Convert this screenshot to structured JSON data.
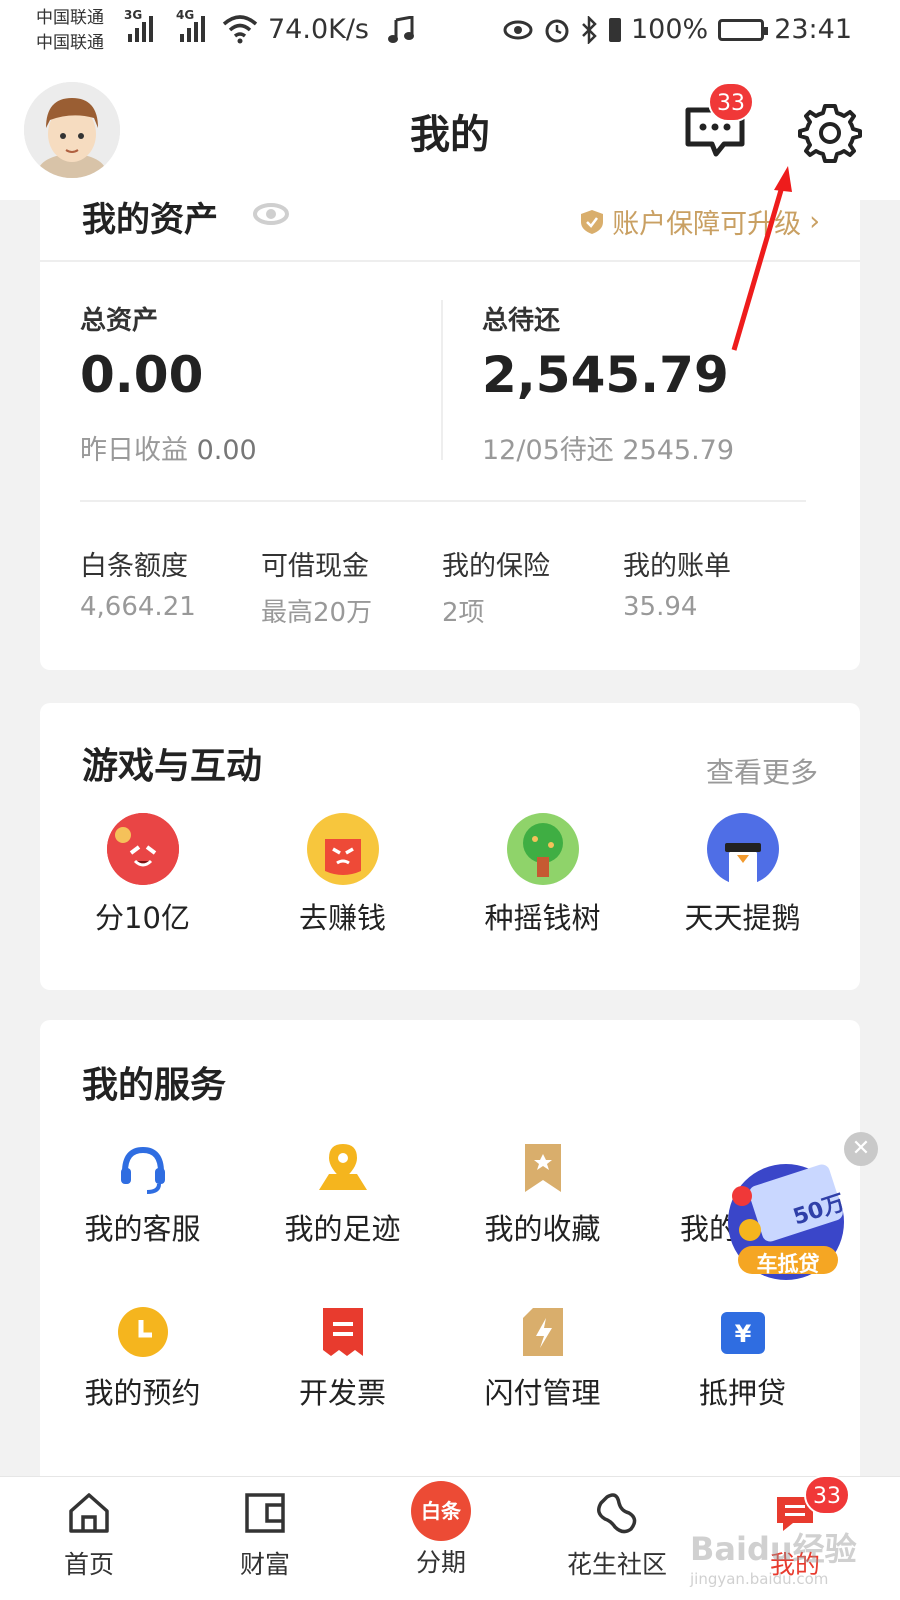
{
  "status_bar": {
    "carrier_1": "中国联通",
    "carrier_2": "中国联通",
    "signal_1": "3G",
    "signal_2": "4G",
    "speed": "74.0K/s",
    "battery": "100%",
    "time": "23:41"
  },
  "header": {
    "title": "我的",
    "message_badge": "33"
  },
  "assets": {
    "title": "我的资产",
    "guarantee_link": "账户保障可升级",
    "total_assets_label": "总资产",
    "total_assets_value": "0.00",
    "yesterday_label": "昨日收益",
    "yesterday_value": "0.00",
    "pending_label": "总待还",
    "pending_value": "2,545.79",
    "pending_sub": "12/05待还 2545.79",
    "stats": [
      {
        "label": "白条额度",
        "value": "4,664.21"
      },
      {
        "label": "可借现金",
        "value": "最高20万"
      },
      {
        "label": "我的保险",
        "value": "2项"
      },
      {
        "label": "我的账单",
        "value": "35.94"
      }
    ]
  },
  "games": {
    "title": "游戏与互动",
    "more": "查看更多",
    "items": [
      {
        "label": "分10亿",
        "icon": "red-packet-monster-icon"
      },
      {
        "label": "去赚钱",
        "icon": "angry-bag-icon"
      },
      {
        "label": "种摇钱树",
        "icon": "money-tree-icon"
      },
      {
        "label": "天天提鹅",
        "icon": "goose-icon"
      }
    ]
  },
  "services": {
    "title": "我的服务",
    "items": [
      {
        "label": "我的客服",
        "icon": "headset-icon"
      },
      {
        "label": "我的足迹",
        "icon": "location-pin-icon"
      },
      {
        "label": "我的收藏",
        "icon": "bookmark-icon"
      },
      {
        "label": "我的",
        "icon": "partial-icon"
      },
      {
        "label": "我的预约",
        "icon": "clock-icon"
      },
      {
        "label": "开发票",
        "icon": "invoice-icon"
      },
      {
        "label": "闪付管理",
        "icon": "quickpay-icon"
      },
      {
        "label": "抵押贷",
        "icon": "yen-bag-icon"
      }
    ]
  },
  "ad": {
    "label": "车抵贷",
    "amount": "50万"
  },
  "tabbar": {
    "items": [
      {
        "label": "首页",
        "icon": "home-icon"
      },
      {
        "label": "财富",
        "icon": "wallet-icon"
      },
      {
        "label": "分期",
        "icon": "baitiao-icon",
        "badge_text": "白条"
      },
      {
        "label": "花生社区",
        "icon": "peanut-icon"
      },
      {
        "label": "我的",
        "icon": "profile-icon"
      }
    ],
    "profile_badge": "33"
  },
  "watermark": {
    "text": "Baidu经验",
    "url": "jingyan.baidu.com"
  },
  "colors": {
    "accent_red": "#e83b2e",
    "gold": "#c9a063",
    "muted": "#999999"
  }
}
